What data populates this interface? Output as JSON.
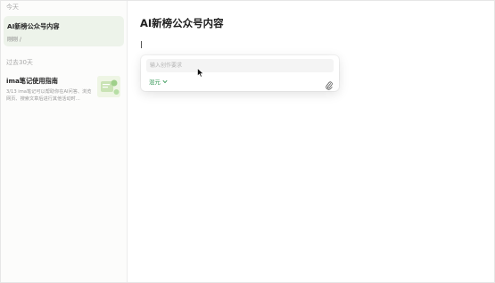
{
  "sidebar": {
    "group_today": "今天",
    "group_30_days": "过去30天",
    "active_note": {
      "title": "AI新榜公众号内容",
      "subtitle": "刚刚 /"
    },
    "note_item": {
      "title": "ima笔记使用指南",
      "excerpt": "3/13 ima笔记可以帮助你在AI问答、浏览网页、搜索文章后进行其他活动时..."
    }
  },
  "editor": {
    "title": "AI新榜公众号内容"
  },
  "ai_popover": {
    "input_placeholder": "输入创作要求",
    "model_label": "混元",
    "icons": {
      "model_dropdown": "chevron-down-icon",
      "attach": "paperclip-icon"
    }
  },
  "colors": {
    "accent": "#3a9a5a",
    "active_note_bg": "#edf3ea"
  }
}
